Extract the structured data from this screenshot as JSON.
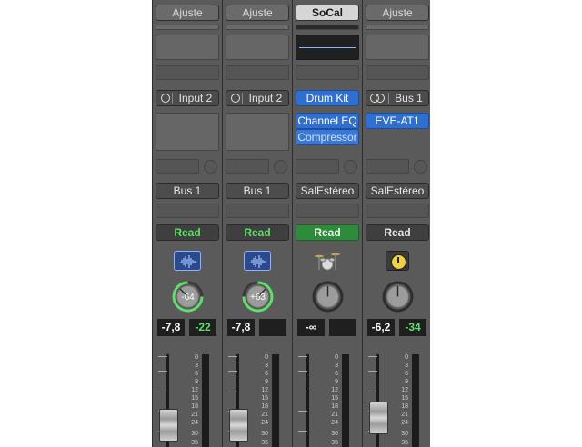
{
  "strips": [
    {
      "setting_label": "Ajuste",
      "input_label": "Input 2",
      "output_label": "Bus 1",
      "automation_label": "Read",
      "pan_value": "-64",
      "volume_value": "-7,8",
      "peak_value": "-22",
      "scale_labels": [
        "0",
        "3",
        "6",
        "9",
        "12",
        "15",
        "18",
        "21",
        "24",
        "30",
        "35"
      ]
    },
    {
      "setting_label": "Ajuste",
      "input_label": "Input 2",
      "output_label": "Bus 1",
      "automation_label": "Read",
      "pan_value": "+63",
      "volume_value": "-7,8",
      "peak_value": "",
      "scale_labels": [
        "0",
        "3",
        "6",
        "9",
        "12",
        "15",
        "18",
        "21",
        "24",
        "30",
        "35"
      ]
    },
    {
      "setting_label": "SoCal",
      "input_label": "Drum Kit",
      "plugins": [
        "Channel EQ",
        "Compressor"
      ],
      "output_label": "SalEstéreo",
      "automation_label": "Read",
      "volume_value": "-∞",
      "peak_value": "",
      "scale_labels": [
        "0",
        "3",
        "6",
        "9",
        "12",
        "15",
        "18",
        "21",
        "24",
        "30",
        "35"
      ]
    },
    {
      "setting_label": "Ajuste",
      "input_label": "Bus 1",
      "plugins": [
        "EVE-AT1"
      ],
      "output_label": "SalEstéreo",
      "automation_label": "Read",
      "volume_value": "-6,2",
      "peak_value": "-34",
      "scale_labels": [
        "0",
        "3",
        "6",
        "9",
        "12",
        "15",
        "18",
        "21",
        "24",
        "30",
        "35"
      ]
    }
  ],
  "colors": {
    "strip_bg": "#5a5a5a",
    "read_green": "#5fe06a",
    "plugin_blue": "#2f6fd1",
    "pan_ring": "#5fe06a",
    "icon_yellow": "#f4d03f"
  }
}
